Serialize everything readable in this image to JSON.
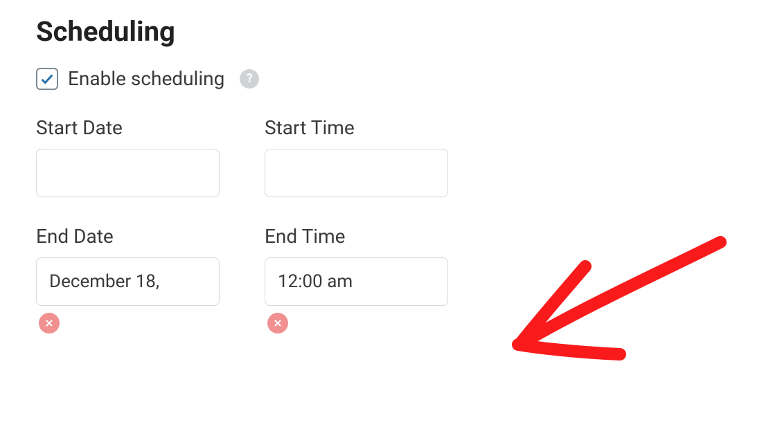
{
  "section": {
    "title": "Scheduling"
  },
  "enable": {
    "label": "Enable scheduling",
    "checked": true
  },
  "fields": {
    "start_date": {
      "label": "Start Date",
      "value": ""
    },
    "start_time": {
      "label": "Start Time",
      "value": ""
    },
    "end_date": {
      "label": "End Date",
      "value": "December 18,"
    },
    "end_time": {
      "label": "End Time",
      "value": "12:00 am"
    }
  },
  "icons": {
    "help_glyph": "?"
  },
  "annotation": {
    "color": "#f91b1b"
  }
}
